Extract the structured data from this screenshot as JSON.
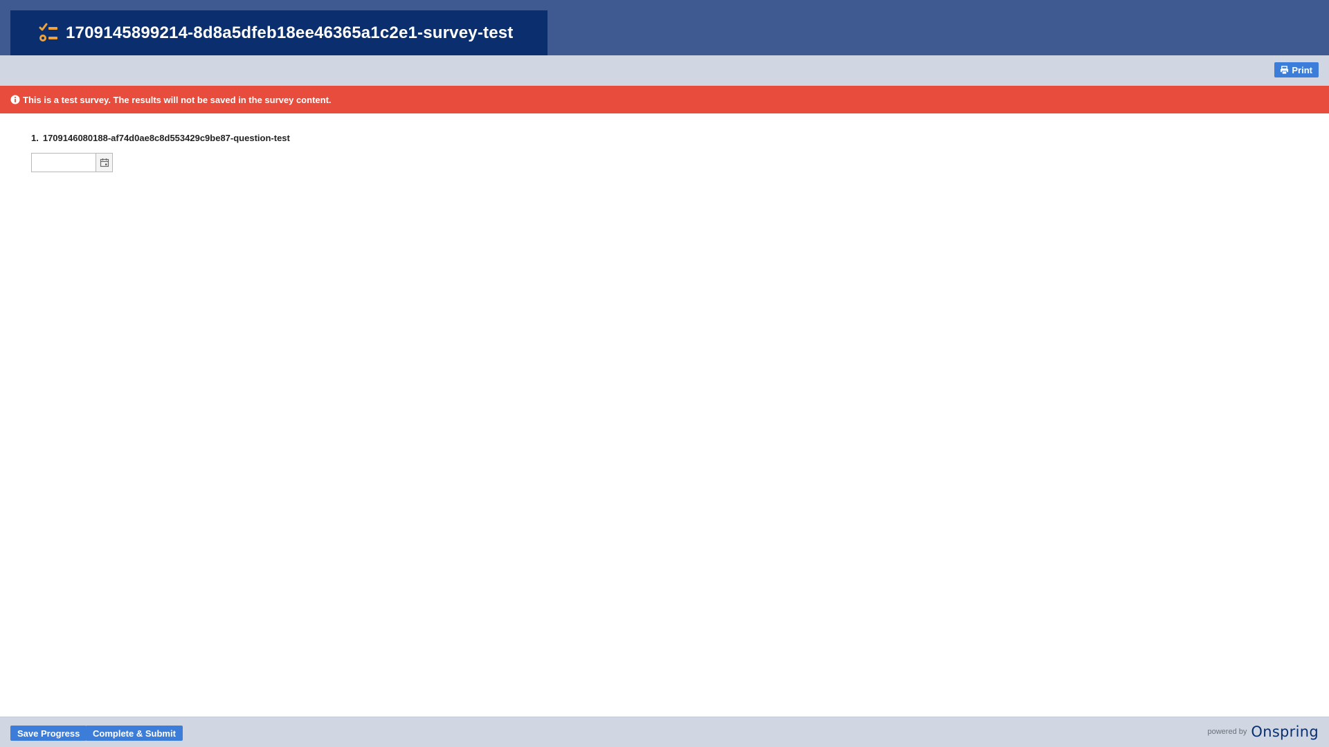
{
  "header": {
    "survey_title": "1709145899214-8d8a5dfeb18ee46365a1c2e1-survey-test",
    "icon": "survey-checklist-icon"
  },
  "toolbar": {
    "print_label": "Print",
    "print_icon": "printer-icon"
  },
  "alert": {
    "icon": "info-circle-icon",
    "text": "This is a test survey. The results will not be saved in the survey content."
  },
  "questions": [
    {
      "number": "1.",
      "label": "1709146080188-af74d0ae8c8d553429c9be87-question-test",
      "type": "date",
      "value": "",
      "picker_icon": "calendar-icon"
    }
  ],
  "footer": {
    "save_label": "Save Progress",
    "submit_label": "Complete & Submit",
    "powered_by": "powered by",
    "brand": "Onspring"
  },
  "colors": {
    "header_band": "#3f5a91",
    "title_box": "#0b2f6e",
    "icon_accent": "#f0a33a",
    "toolbar": "#d0d7e3",
    "alert": "#e74c3c",
    "button": "#3b7dd8"
  }
}
